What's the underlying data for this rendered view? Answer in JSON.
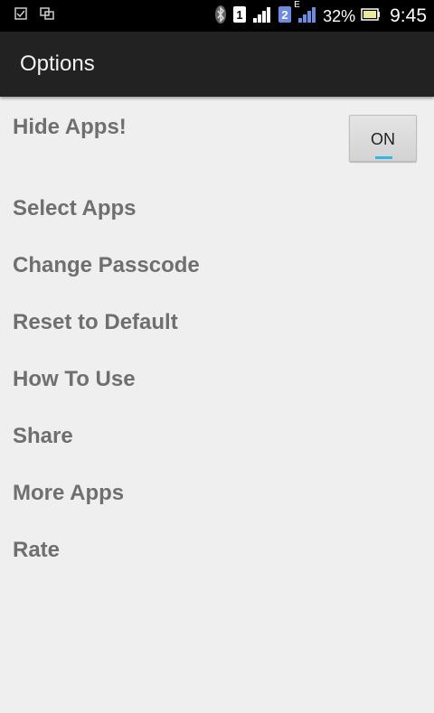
{
  "status_bar": {
    "sim1": "1",
    "sim2": "2",
    "network_type": "E",
    "battery": "32%",
    "time": "9:45"
  },
  "app_bar": {
    "title": "Options"
  },
  "hide_apps": {
    "label": "Hide Apps!",
    "toggle": "ON"
  },
  "menu": [
    "Select Apps",
    "Change Passcode",
    "Reset to Default",
    "How To Use",
    "Share",
    "More Apps",
    "Rate"
  ],
  "colors": {
    "toggle_accent": "#33b5e5",
    "action_bar": "#222222"
  }
}
